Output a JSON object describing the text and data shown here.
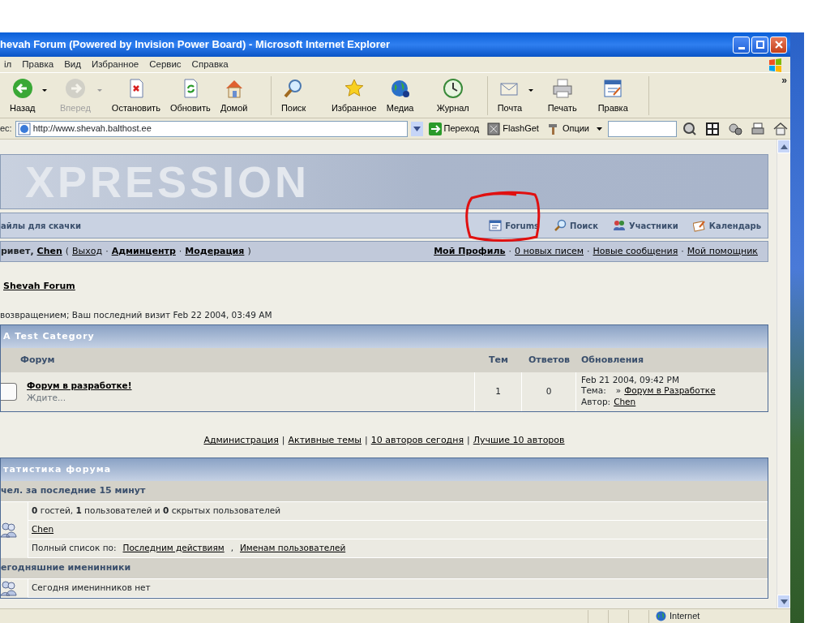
{
  "window": {
    "title": "hevah Forum (Powered by Invision Power Board) - Microsoft Internet Explorer"
  },
  "menu": [
    "іл",
    "Правка",
    "Вид",
    "Избранное",
    "Сервис",
    "Справка"
  ],
  "toolbar": {
    "overflow": "»",
    "groups": [
      {
        "buttons": [
          {
            "label": "Назад",
            "disabled": false,
            "dropdown": true
          },
          {
            "label": "Вперед",
            "disabled": true,
            "dropdown": true
          },
          {
            "label": "Остановить",
            "disabled": false,
            "dropdown": false
          },
          {
            "label": "Обновить",
            "disabled": false,
            "dropdown": false
          },
          {
            "label": "Домой",
            "disabled": false,
            "dropdown": false
          }
        ]
      },
      {
        "buttons": [
          {
            "label": "Поиск",
            "disabled": false,
            "dropdown": false
          },
          {
            "label": "Избранное",
            "disabled": false,
            "dropdown": false
          },
          {
            "label": "Медиа",
            "disabled": false,
            "dropdown": false
          },
          {
            "label": "Журнал",
            "disabled": false,
            "dropdown": false
          }
        ]
      },
      {
        "buttons": [
          {
            "label": "Почта",
            "disabled": false,
            "dropdown": true
          },
          {
            "label": "Печать",
            "disabled": false,
            "dropdown": false
          },
          {
            "label": "Правка",
            "disabled": false,
            "dropdown": false
          }
        ]
      }
    ]
  },
  "address": {
    "label": "ес:",
    "url": "http://www.shevah.balthost.ee",
    "go": "Переход",
    "links": [
      {
        "label": "FlashGet",
        "dropdown": false
      },
      {
        "label": "Опции",
        "dropdown": true
      }
    ]
  },
  "banner": {
    "logo": "XPRESSION"
  },
  "nav": {
    "left": "айлы для скачки",
    "items": [
      "Forums",
      "Поиск",
      "Участники",
      "Календарь"
    ]
  },
  "user_bar": {
    "left": [
      {
        "kind": "bold",
        "text": "ривет,"
      },
      {
        "kind": "bold-link",
        "text": "Chen"
      },
      {
        "kind": "text",
        "text": "("
      },
      {
        "kind": "link",
        "text": "Выход"
      },
      {
        "kind": "text",
        "text": "·"
      },
      {
        "kind": "bold-link",
        "text": "Админцентр"
      },
      {
        "kind": "text",
        "text": "·"
      },
      {
        "kind": "bold-link",
        "text": "Модерация"
      },
      {
        "kind": "text",
        "text": ")"
      }
    ],
    "right": [
      {
        "kind": "bold-link",
        "text": "Мой Профиль"
      },
      {
        "kind": "text",
        "text": "·"
      },
      {
        "kind": "link",
        "text": "0 новых писем"
      },
      {
        "kind": "text",
        "text": "·"
      },
      {
        "kind": "link",
        "text": "Новые сообщения"
      },
      {
        "kind": "text",
        "text": "·"
      },
      {
        "kind": "link",
        "text": "Мой помощник"
      }
    ]
  },
  "breadcrumb": "Shevah Forum",
  "welcome": "возвращением; Ваш последний визит Feb 22 2004, 03:49 AM",
  "category": {
    "title": "A Test Category",
    "columns": [
      "Форум",
      "Тем",
      "Ответов",
      "Обновления"
    ],
    "rows": [
      {
        "name": "Форум в разработке!",
        "description": "Ждите...",
        "topics": "1",
        "replies": "0",
        "last_date": "Feb 21 2004, 09:42 PM",
        "topic_label": "Тема:",
        "topic_marker": "»",
        "topic": "Форум в Разработке",
        "author_label": "Автор:",
        "author": "Chen"
      }
    ]
  },
  "links": [
    {
      "kind": "link",
      "text": "Администрация"
    },
    {
      "kind": "text",
      "text": "|"
    },
    {
      "kind": "link",
      "text": "Активные темы"
    },
    {
      "kind": "text",
      "text": "|"
    },
    {
      "kind": "link",
      "text": "10 авторов сегодня"
    },
    {
      "kind": "text",
      "text": "|"
    },
    {
      "kind": "link",
      "text": "Лучшие 10 авторов"
    }
  ],
  "stats": {
    "title": "татистика форума",
    "sections": [
      {
        "heading": "чел. за последние 15 минут",
        "rows": [
          [
            {
              "kind": "rich",
              "text": "**0** гостей, **1** пользователей и **0** скрытых пользователей"
            }
          ],
          [
            {
              "kind": "link",
              "text": "Chen"
            }
          ],
          [
            {
              "kind": "text",
              "text": "Полный список по:"
            },
            {
              "kind": "link",
              "text": "Последним действиям"
            },
            {
              "kind": "text",
              "text": ","
            },
            {
              "kind": "link",
              "text": "Именам пользователей"
            }
          ]
        ]
      },
      {
        "heading": "егодняшние именинники",
        "rows": [
          [
            {
              "kind": "text",
              "text": "Сегодня именинников нет"
            }
          ]
        ]
      }
    ]
  },
  "status_bar": {
    "zone": "Internet"
  }
}
